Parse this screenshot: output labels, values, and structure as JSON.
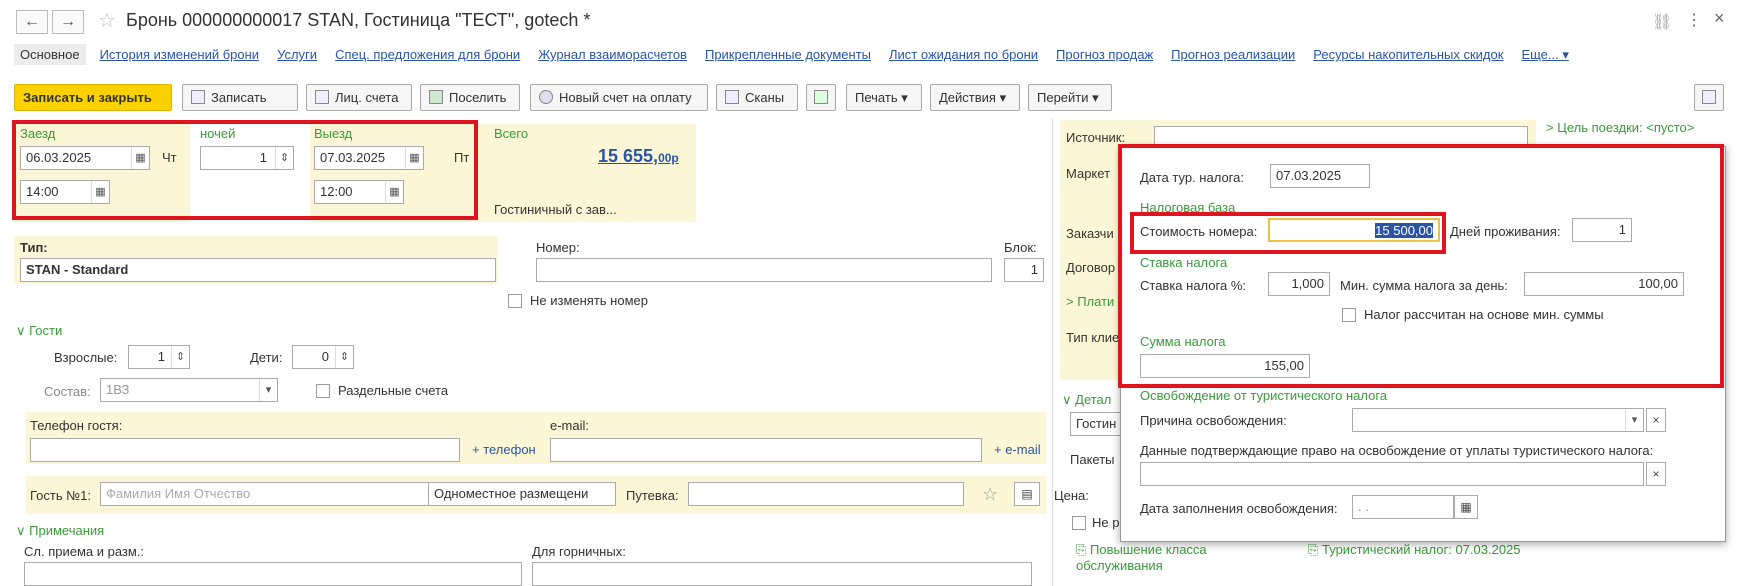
{
  "header": {
    "title": "Бронь 000000000017 STAN, Гостиница \"ТЕСТ\", gotech *",
    "back": "←",
    "forward": "→",
    "star": "☆"
  },
  "tabs": [
    "Основное",
    "История изменений брони",
    "Услуги",
    "Спец. предложения для брони",
    "Журнал взаиморасчетов",
    "Прикрепленные документы",
    "Лист ожидания по брони",
    "Прогноз продаж",
    "Прогноз реализации",
    "Ресурсы накопительных скидок",
    "Еще..."
  ],
  "toolbar": {
    "save_close": "Записать и закрыть",
    "save": "Записать",
    "accounts": "Лиц. счета",
    "settle": "Поселить",
    "new_invoice": "Новый счет на оплату",
    "scans": "Сканы",
    "print": "Печать",
    "actions": "Действия",
    "goto": "Перейти"
  },
  "dates": {
    "checkin_label": "Заезд",
    "checkin_date": "06.03.2025",
    "checkin_dow": "Чт",
    "checkin_time": "14:00",
    "nights_label": "ночей",
    "nights": "1",
    "checkout_label": "Выезд",
    "checkout_date": "07.03.2025",
    "checkout_dow": "Пт",
    "checkout_time": "12:00"
  },
  "total": {
    "label": "Всего",
    "amount": "15 655,",
    "kopecks": "00р",
    "subtitle": "Гостиничный с зав..."
  },
  "room": {
    "type_label": "Тип:",
    "type_value": "STAN - Standard",
    "number_label": "Номер:",
    "block_label": "Блок:",
    "block_value": "1",
    "keep_number": "Не изменять номер"
  },
  "guests": {
    "section": "Гости",
    "adults_label": "Взрослые:",
    "adults": "1",
    "children_label": "Дети:",
    "children": "0",
    "composition_label": "Состав:",
    "composition": "1ВЗ",
    "separate_accounts": "Раздельные счета",
    "phone_label": "Телефон гостя:",
    "add_phone": "+ телефон",
    "email_label": "e-mail:",
    "add_email": "+ e-mail",
    "guest_label": "Гость №1:",
    "guest_placeholder": "Фамилия Имя Отчество",
    "placement": "Одноместное размещени",
    "voucher_label": "Путевка:"
  },
  "notes": {
    "section": "Примечания",
    "reception_label": "Сл. приема и разм.:",
    "maids_label": "Для горничных:"
  },
  "right": {
    "source_label": "Источник:",
    "market_label": "Маркет",
    "customer_label": "Заказчи",
    "contract_label": "Договор",
    "payer_label": "Плати",
    "client_type_label": "Тип клие",
    "details_label": "Детал",
    "hotel_value": "Гостин",
    "packages_label": "Пакеты",
    "price_label": "Цена:",
    "not_label": "Не р",
    "upgrade_link": "Повышение класса обслуживания",
    "tourist_tax_link": "Туристический налог: 07.03.2025",
    "trip_goal": "Цель поездки: <пусто>"
  },
  "popup": {
    "tax_date_label": "Дата тур. налога:",
    "tax_date": "07.03.2025",
    "tax_base_section": "Налоговая база",
    "room_cost_label": "Стоимость номера:",
    "room_cost": "15 500,00",
    "days_label": "Дней проживания:",
    "days": "1",
    "rate_section": "Ставка налога",
    "rate_label": "Ставка налога %:",
    "rate": "1,000",
    "min_sum_label": "Мин. сумма налога за день:",
    "min_sum": "100,00",
    "min_based": "Налог рассчитан на основе мин. суммы",
    "tax_sum_section": "Сумма налога",
    "tax_sum": "155,00",
    "exempt_section": "Освобождение от туристического налога",
    "reason_label": "Причина освобождения:",
    "proof_label": "Данные подтверждающие право на освобождение от уплаты туристического налога:",
    "fill_date_label": "Дата заполнения освобождения:",
    "fill_date": ". ."
  }
}
